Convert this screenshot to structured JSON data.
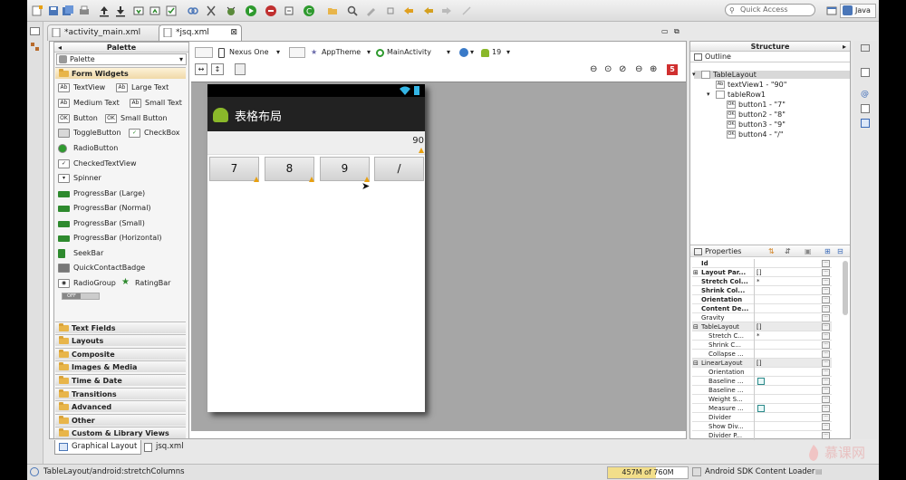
{
  "toolbar": {
    "quick_access_placeholder": "Quick Access",
    "perspective_label": "Java"
  },
  "tabs": [
    {
      "label": "*activity_main.xml"
    },
    {
      "label": "*jsq.xml"
    }
  ],
  "palette": {
    "title": "Palette",
    "selector_label": "Palette",
    "active_category": "Form Widgets",
    "widgets": {
      "textview": "TextView",
      "large_text": "Large Text",
      "medium_text": "Medium Text",
      "small_text": "Small Text",
      "button": "Button",
      "small_button": "Small Button",
      "togglebutton": "ToggleButton",
      "checkbox": "CheckBox",
      "radiobutton": "RadioButton",
      "checkedtextview": "CheckedTextView",
      "spinner": "Spinner",
      "progress_large": "ProgressBar (Large)",
      "progress_normal": "ProgressBar (Normal)",
      "progress_small": "ProgressBar (Small)",
      "progress_horizontal": "ProgressBar (Horizontal)",
      "seekbar": "SeekBar",
      "quickcontactbadge": "QuickContactBadge",
      "radiogroup": "RadioGroup",
      "ratingbar": "RatingBar",
      "switch_off": "OFF"
    },
    "categories": [
      "Text Fields",
      "Layouts",
      "Composite",
      "Images & Media",
      "Time & Date",
      "Transitions",
      "Advanced",
      "Other",
      "Custom & Library Views"
    ]
  },
  "editor": {
    "device": "Nexus One",
    "theme": "AppTheme",
    "activity": "MainActivity",
    "api_level": "19",
    "error_count": "5",
    "bottom_tabs": [
      "Graphical Layout",
      "jsq.xml"
    ]
  },
  "preview": {
    "app_title": "表格布局",
    "display_value": "90",
    "buttons": [
      "7",
      "8",
      "9",
      "/"
    ]
  },
  "structure": {
    "title": "Structure",
    "outline_title": "Outline",
    "tree": [
      {
        "label": "TableLayout"
      },
      {
        "label": "textView1 - \"90\""
      },
      {
        "label": "tableRow1"
      },
      {
        "label": "button1 - \"7\""
      },
      {
        "label": "button2 - \"8\""
      },
      {
        "label": "button3 - \"9\""
      },
      {
        "label": "button4 - \"/\""
      }
    ],
    "properties_title": "Properties",
    "properties": [
      {
        "name": "Id",
        "value": ""
      },
      {
        "name": "Layout Par...",
        "value": "[]"
      },
      {
        "name": "Stretch Col...",
        "value": "*"
      },
      {
        "name": "Shrink Col...",
        "value": ""
      },
      {
        "name": "Orientation",
        "value": ""
      },
      {
        "name": "Content De...",
        "value": ""
      },
      {
        "name": "Gravity",
        "value": ""
      },
      {
        "name": "TableLayout",
        "value": "[]"
      },
      {
        "name": "Stretch C...",
        "value": "*"
      },
      {
        "name": "Shrink C...",
        "value": ""
      },
      {
        "name": "Collapse ...",
        "value": ""
      },
      {
        "name": "LinearLayout",
        "value": "[]"
      },
      {
        "name": "Orientation",
        "value": ""
      },
      {
        "name": "Baseline ...",
        "value": ""
      },
      {
        "name": "Baseline ...",
        "value": ""
      },
      {
        "name": "Weight S...",
        "value": ""
      },
      {
        "name": "Measure ...",
        "value": ""
      },
      {
        "name": "Divider",
        "value": ""
      },
      {
        "name": "Show Div...",
        "value": ""
      },
      {
        "name": "Divider P...",
        "value": ""
      }
    ]
  },
  "statusbar": {
    "path": "TableLayout/android:stretchColumns",
    "memory": "457M of 760M",
    "memory_fraction": 0.6,
    "loader": "Android SDK Content Loader"
  },
  "watermark": "慕课网"
}
